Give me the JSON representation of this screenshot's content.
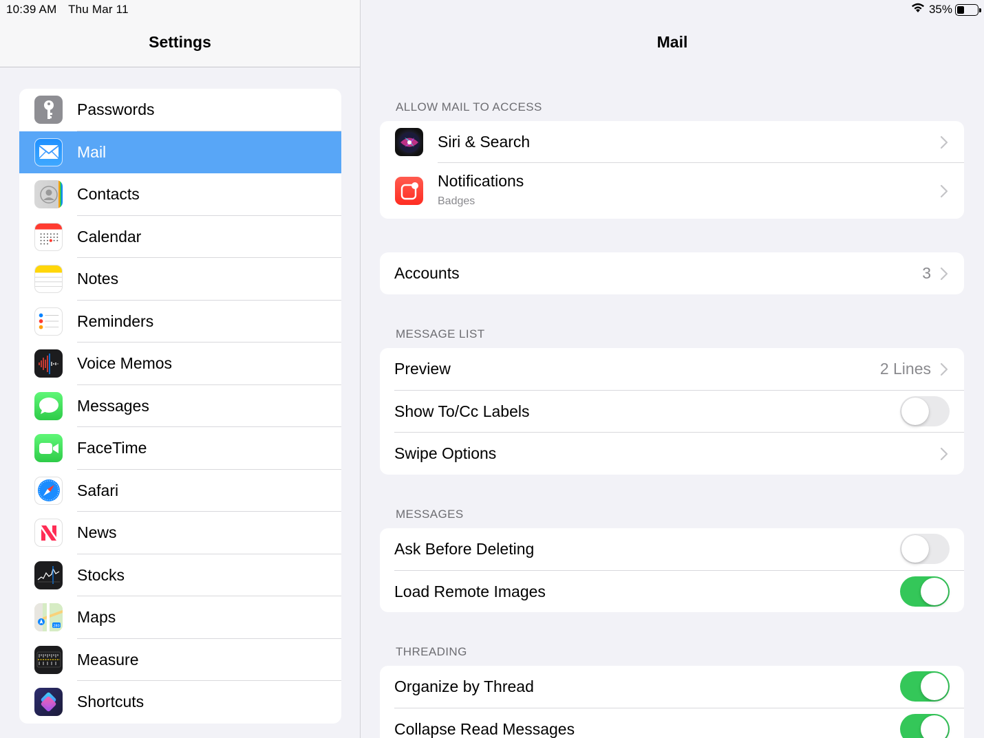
{
  "status": {
    "time": "10:39 AM",
    "date": "Thu Mar 11",
    "battery": "35%",
    "battery_level": 0.35
  },
  "sidebar": {
    "title": "Settings",
    "items": [
      {
        "label": "Passwords",
        "icon": "key-icon"
      },
      {
        "label": "Mail",
        "icon": "mail-icon",
        "selected": true
      },
      {
        "label": "Contacts",
        "icon": "contacts-icon"
      },
      {
        "label": "Calendar",
        "icon": "calendar-icon"
      },
      {
        "label": "Notes",
        "icon": "notes-icon"
      },
      {
        "label": "Reminders",
        "icon": "reminders-icon"
      },
      {
        "label": "Voice Memos",
        "icon": "voice-memos-icon"
      },
      {
        "label": "Messages",
        "icon": "messages-icon"
      },
      {
        "label": "FaceTime",
        "icon": "facetime-icon"
      },
      {
        "label": "Safari",
        "icon": "safari-icon"
      },
      {
        "label": "News",
        "icon": "news-icon"
      },
      {
        "label": "Stocks",
        "icon": "stocks-icon"
      },
      {
        "label": "Maps",
        "icon": "maps-icon"
      },
      {
        "label": "Measure",
        "icon": "measure-icon"
      },
      {
        "label": "Shortcuts",
        "icon": "shortcuts-icon"
      }
    ]
  },
  "main": {
    "title": "Mail",
    "allow_access": {
      "header": "ALLOW MAIL TO ACCESS",
      "siri": "Siri & Search",
      "notifications": "Notifications",
      "notifications_sub": "Badges"
    },
    "accounts": {
      "label": "Accounts",
      "value": "3"
    },
    "message_list": {
      "header": "MESSAGE LIST",
      "preview": "Preview",
      "preview_value": "2 Lines",
      "show_tocc": "Show To/Cc Labels",
      "show_tocc_on": false,
      "swipe": "Swipe Options"
    },
    "messages": {
      "header": "MESSAGES",
      "ask_delete": "Ask Before Deleting",
      "ask_delete_on": false,
      "load_remote": "Load Remote Images",
      "load_remote_on": true
    },
    "threading": {
      "header": "THREADING",
      "organize": "Organize by Thread",
      "organize_on": true,
      "collapse": "Collapse Read Messages",
      "collapse_on": true
    }
  },
  "colors": {
    "selected_bg": "#58a6f7",
    "toggle_on": "#34c759",
    "toggle_off": "#e9e9eb"
  }
}
